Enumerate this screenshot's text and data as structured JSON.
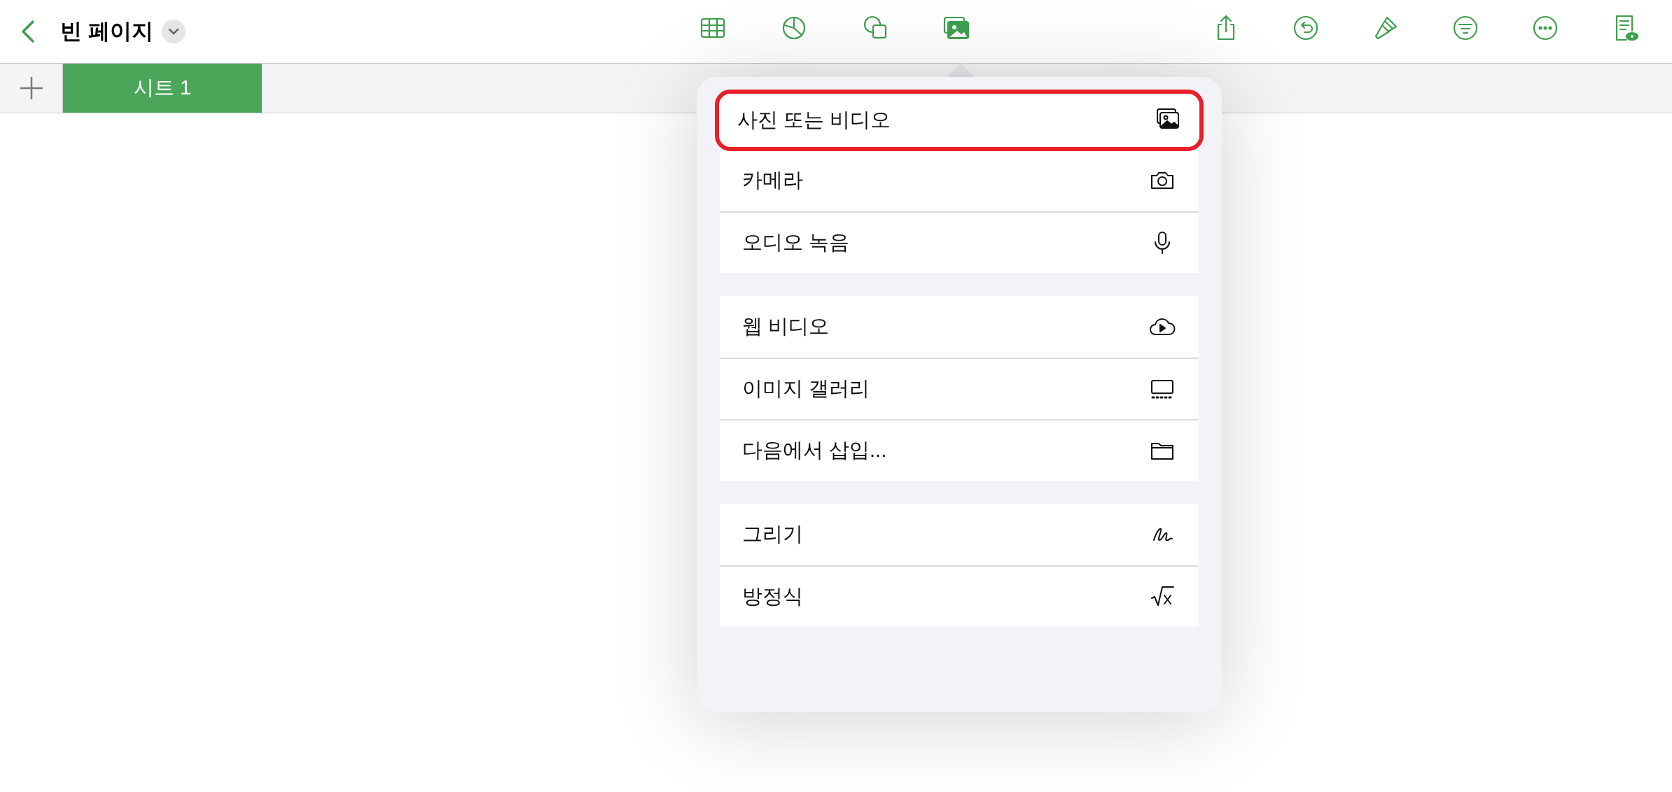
{
  "title": "빈 페이지",
  "tabs": [
    {
      "label": "시트 1",
      "selected": true
    }
  ],
  "menu": {
    "groups": [
      {
        "items": [
          {
            "label": "사진 또는 비디오",
            "highlighted": true
          },
          {
            "label": "카메라",
            "highlighted": false
          },
          {
            "label": "오디오 녹음",
            "highlighted": false
          }
        ]
      },
      {
        "items": [
          {
            "label": "웹 비디오",
            "highlighted": false
          },
          {
            "label": "이미지 갤러리",
            "highlighted": false
          },
          {
            "label": "다음에서 삽입...",
            "highlighted": false
          }
        ]
      },
      {
        "items": [
          {
            "label": "그리기",
            "highlighted": false
          },
          {
            "label": "방정식",
            "highlighted": false
          }
        ]
      }
    ]
  }
}
